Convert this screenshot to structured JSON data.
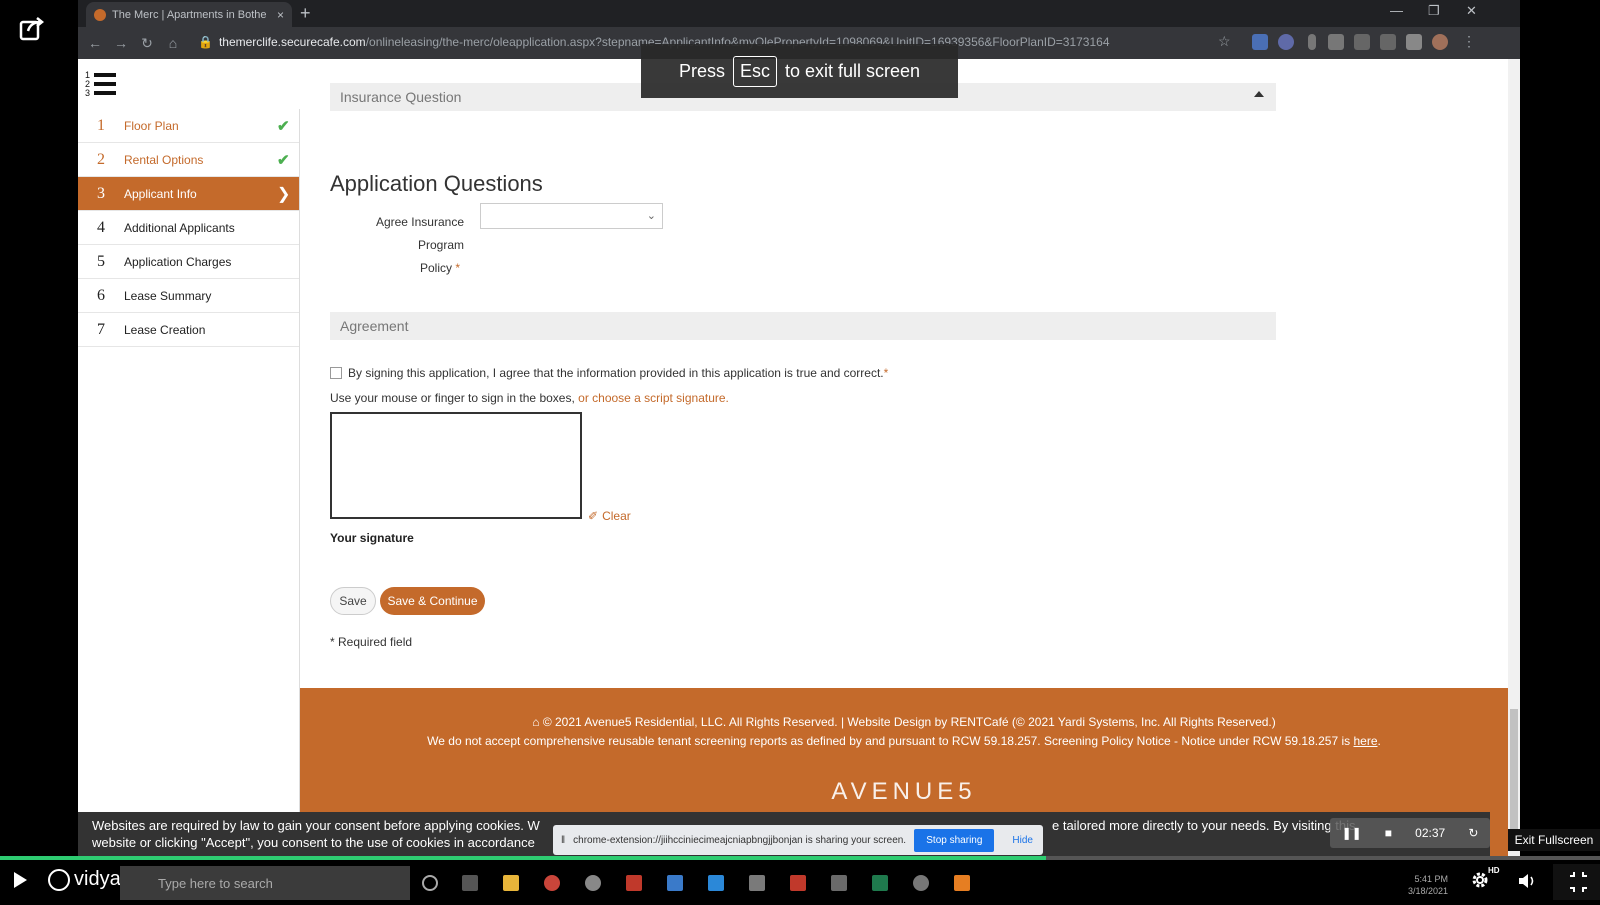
{
  "browser": {
    "tab_title": "The Merc | Apartments in Bothe",
    "tab_close": "×",
    "new_tab": "+",
    "url_host": "themerclife.securecafe.com",
    "url_path": "/onlineleasing/the-merc/oleapplication.aspx?stepname=ApplicantInfo&myOlePropertyId=1098069&UnitID=16939356&FloorPlanID=3173164"
  },
  "fullscreen_toast": {
    "before": "Press",
    "key": "Esc",
    "after": "to exit full screen"
  },
  "steps": [
    {
      "num": "1",
      "label": "Floor Plan",
      "state": "done"
    },
    {
      "num": "2",
      "label": "Rental Options",
      "state": "done"
    },
    {
      "num": "3",
      "label": "Applicant Info",
      "state": "active"
    },
    {
      "num": "4",
      "label": "Additional Applicants",
      "state": "pending"
    },
    {
      "num": "5",
      "label": "Application Charges",
      "state": "pending"
    },
    {
      "num": "6",
      "label": "Lease Summary",
      "state": "pending"
    },
    {
      "num": "7",
      "label": "Lease Creation",
      "state": "pending"
    }
  ],
  "form": {
    "insurance_section": "Insurance Question",
    "app_questions_title": "Application Questions",
    "agree_label_line1": "Agree Insurance Program",
    "agree_label_line2": "Policy",
    "required_mark": "*",
    "agree_value": "",
    "agreement_section": "Agreement",
    "sign_statement": "By signing this application, I agree that the information provided in this application is true and correct.",
    "sign_instructions": "Use your mouse or finger to sign in the boxes,",
    "script_signature_link": "or choose a script signature.",
    "clear_label": "Clear",
    "signature_label": "Your signature",
    "save_label": "Save",
    "save_continue_label": "Save & Continue",
    "required_note": "* Required field"
  },
  "footer": {
    "copyright": "© 2021 Avenue5 Residential, LLC. All Rights Reserved. | Website Design by RENTCafé (© 2021 Yardi Systems, Inc. All Rights Reserved.)",
    "policy_text": "We do not accept comprehensive reusable tenant screening reports as defined by and pursuant to RCW 59.18.257. Screening Policy Notice - Notice under RCW 59.18.257 is",
    "policy_link": "here",
    "logo_text": "AVENUE5"
  },
  "cookie_banner": {
    "line1": "Websites are required by law to gain your consent before applying cookies. W",
    "line2": "website or clicking \"Accept\", you consent to the use of cookies in accordance",
    "line1_end": "e tailored more directly to your needs. By visiting this"
  },
  "share_bar": {
    "message": "chrome-extension://jiihcciniecimeajcniapbngjjbonjan is sharing your screen.",
    "stop_label": "Stop sharing",
    "hide_label": "Hide"
  },
  "recording": {
    "time": "02:37"
  },
  "player": {
    "brand": "vidyard",
    "progress": 0.654,
    "hd_badge": "HD",
    "exit_tooltip": "Exit Fullscreen"
  },
  "taskbar": {
    "search_placeholder": "Type here to search",
    "time": "5:41 PM",
    "date": "3/18/2021"
  },
  "colors": {
    "accent": "#c46a2b",
    "progress": "#2ecc71",
    "check": "#4caf50"
  }
}
